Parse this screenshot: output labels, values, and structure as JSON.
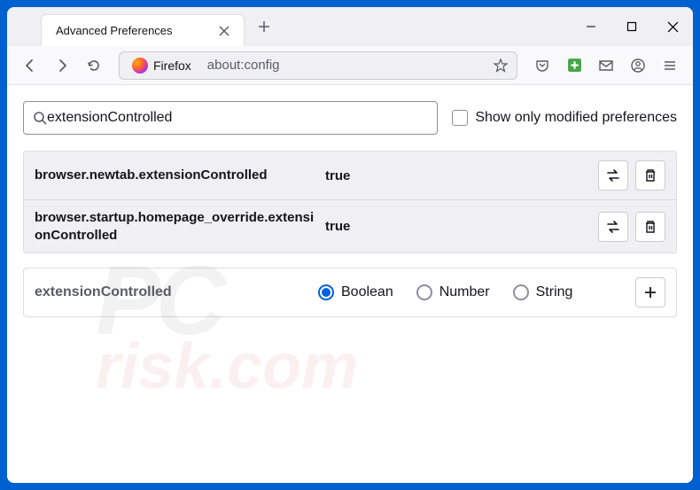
{
  "tab": {
    "title": "Advanced Preferences"
  },
  "urlbar": {
    "chip": "Firefox",
    "url": "about:config"
  },
  "search": {
    "value": "extensionControlled",
    "show_only_label": "Show only modified preferences"
  },
  "prefs": [
    {
      "name": "browser.newtab.extensionControlled",
      "value": "true"
    },
    {
      "name": "browser.startup.homepage_override.extensionControlled",
      "value": "true"
    }
  ],
  "newpref": {
    "name": "extensionControlled",
    "types": {
      "boolean": "Boolean",
      "number": "Number",
      "string": "String"
    },
    "selected": "boolean"
  }
}
